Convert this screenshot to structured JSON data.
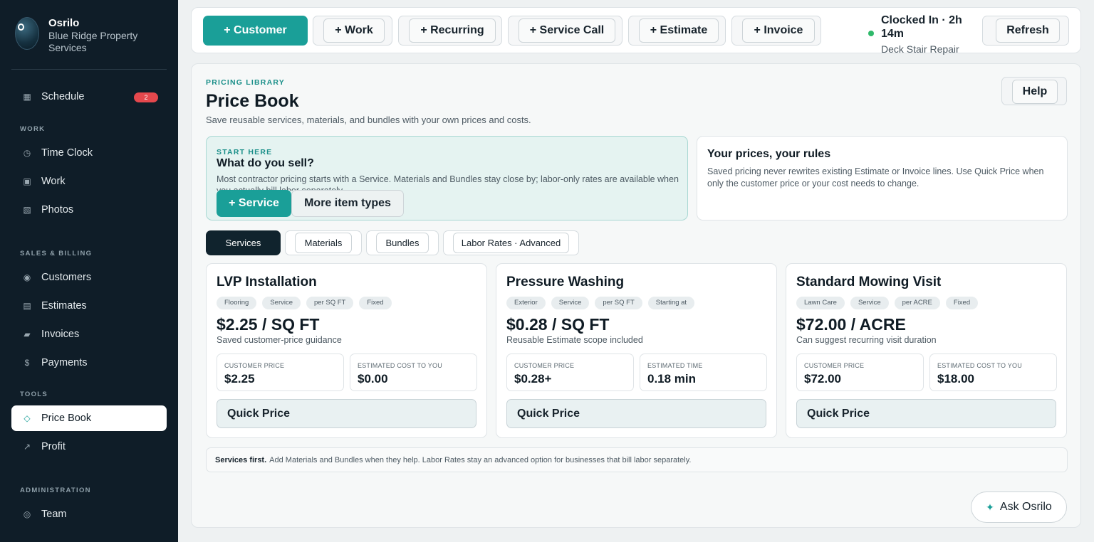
{
  "sidebar": {
    "brand_name": "Osrilo",
    "brand_sub": "Blue Ridge Property Services",
    "sections": {
      "work": "WORK",
      "sales": "SALES & BILLING",
      "tools": "TOOLS",
      "admin": "ADMINISTRATION"
    },
    "items": {
      "schedule": {
        "label": "Schedule",
        "badge": "2"
      },
      "time_clock": {
        "label": "Time Clock"
      },
      "work": {
        "label": "Work"
      },
      "photos": {
        "label": "Photos"
      },
      "customers": {
        "label": "Customers"
      },
      "estimates": {
        "label": "Estimates"
      },
      "invoices": {
        "label": "Invoices"
      },
      "payments": {
        "label": "Payments"
      },
      "price_book": {
        "label": "Price Book"
      },
      "profit": {
        "label": "Profit"
      },
      "team": {
        "label": "Team"
      }
    }
  },
  "topbar": {
    "customer": "+ Customer",
    "work": "+ Work",
    "recurring": "+ Recurring",
    "service_call": "+ Service Call",
    "estimate": "+ Estimate",
    "invoice": "+ Invoice",
    "clock_status": "Clocked In · 2h 14m",
    "clock_job": "Deck Stair Repair",
    "refresh": "Refresh"
  },
  "page": {
    "eyebrow": "PRICING LIBRARY",
    "title": "Price Book",
    "subtitle": "Save reusable services, materials, and bundles with your own prices and costs.",
    "help": "Help"
  },
  "start": {
    "eyebrow": "START HERE",
    "question": "What do you sell?",
    "desc": "Most contractor pricing starts with a Service. Materials and Bundles stay close by; labor-only rates are available when you actually bill labor separately.",
    "service_btn": "+ Service",
    "more_btn": "More item types"
  },
  "rules": {
    "title": "Your prices, your rules",
    "desc": "Saved pricing never rewrites existing Estimate or Invoice lines. Use Quick Price when only the customer price or your cost needs to change."
  },
  "tabs": {
    "services": "Services",
    "materials": "Materials",
    "bundles": "Bundles",
    "labor": "Labor Rates · Advanced"
  },
  "cards": [
    {
      "name": "LVP Installation",
      "chips": [
        "Flooring",
        "Service",
        "per SQ FT",
        "Fixed"
      ],
      "price": "$2.25 / SQ FT",
      "note": "Saved customer-price guidance",
      "stat1_label": "CUSTOMER PRICE",
      "stat1_value": "$2.25",
      "stat2_label": "ESTIMATED COST TO YOU",
      "stat2_value": "$0.00",
      "action": "Quick Price"
    },
    {
      "name": "Pressure Washing",
      "chips": [
        "Exterior",
        "Service",
        "per SQ FT",
        "Starting at"
      ],
      "price": "$0.28 / SQ FT",
      "note": "Reusable Estimate scope included",
      "stat1_label": "CUSTOMER PRICE",
      "stat1_value": "$0.28+",
      "stat2_label": "ESTIMATED TIME",
      "stat2_value": "0.18 min",
      "action": "Quick Price"
    },
    {
      "name": "Standard Mowing Visit",
      "chips": [
        "Lawn Care",
        "Service",
        "per ACRE",
        "Fixed"
      ],
      "price": "$72.00 / ACRE",
      "note": "Can suggest recurring visit duration",
      "stat1_label": "CUSTOMER PRICE",
      "stat1_value": "$72.00",
      "stat2_label": "ESTIMATED COST TO YOU",
      "stat2_value": "$18.00",
      "action": "Quick Price"
    }
  ],
  "footer": {
    "bold": "Services first.",
    "text": "Add Materials and Bundles when they help. Labor Rates stay an advanced option for businesses that bill labor separately."
  },
  "ask": {
    "label": "Ask Osrilo"
  },
  "colors": {
    "accent": "#1a9f98",
    "sidebar": "#0f1d28",
    "badge": "#e5484d",
    "status": "#2fb96a"
  },
  "icons": [
    "calendar-icon",
    "clock-icon",
    "briefcase-icon",
    "photo-icon",
    "customer-icon",
    "estimate-icon",
    "invoice-icon",
    "dollar-icon",
    "diamond-icon",
    "trend-icon",
    "team-icon",
    "sparkle-icon"
  ]
}
